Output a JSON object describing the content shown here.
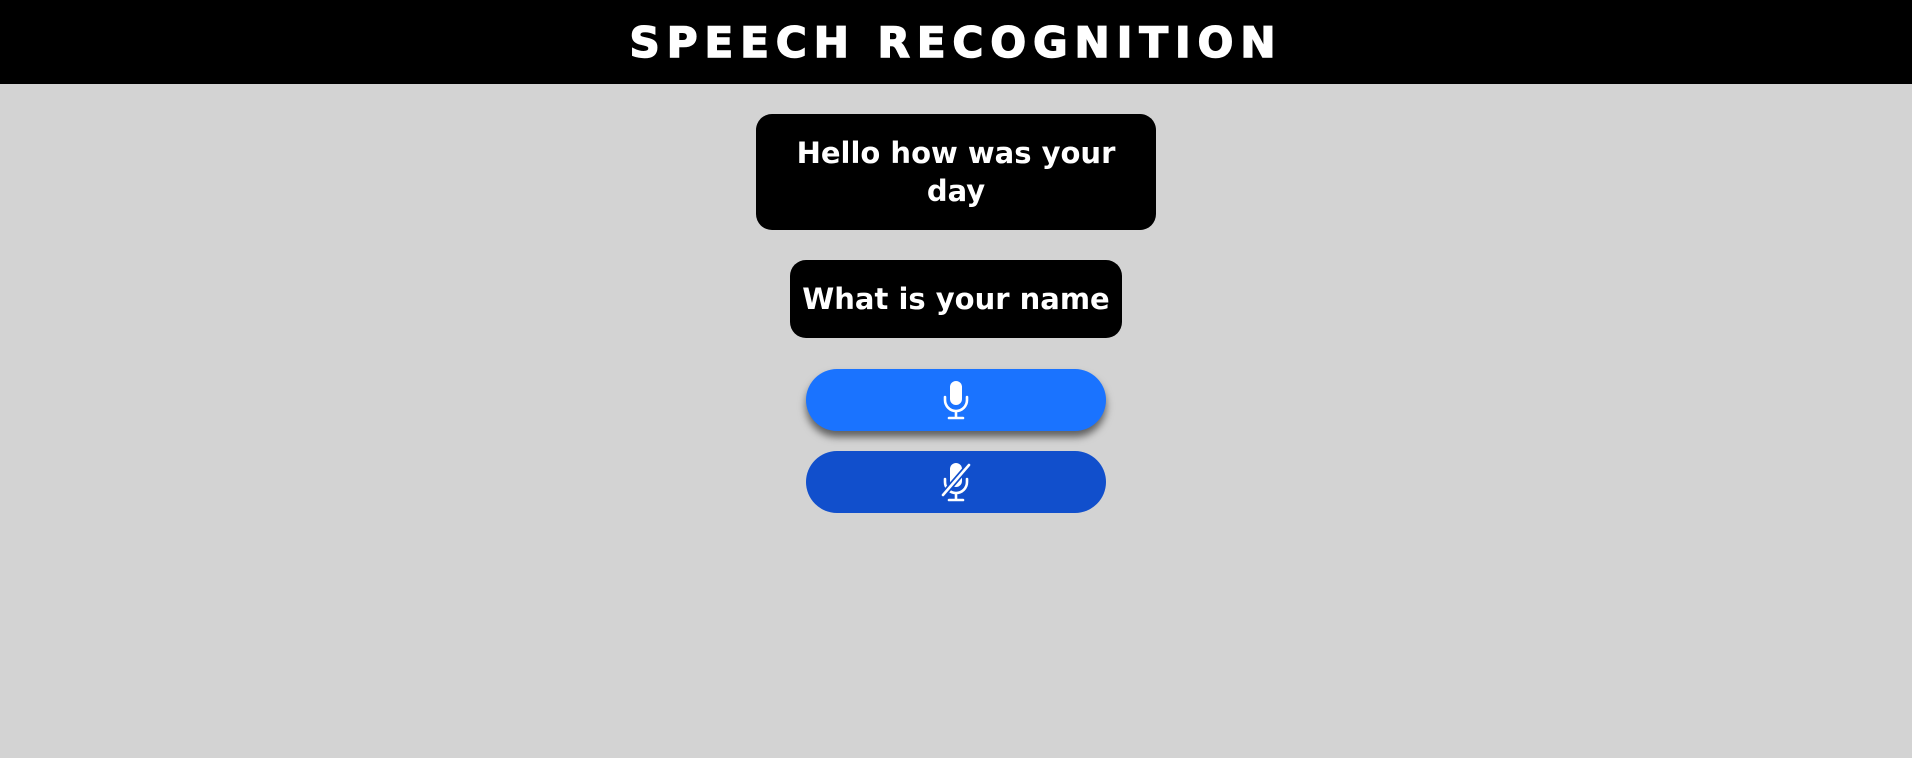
{
  "header": {
    "title": "Speech Recognition"
  },
  "transcripts": [
    {
      "text": "Hello how was your day"
    },
    {
      "text": "What is your name"
    }
  ],
  "controls": {
    "start_icon": "microphone-icon",
    "stop_icon": "microphone-slash-icon"
  },
  "colors": {
    "header_bg": "#000000",
    "page_bg": "#d3d3d3",
    "bubble_bg": "#000000",
    "start_button": "#1a73ff",
    "stop_button": "#114fcc"
  }
}
